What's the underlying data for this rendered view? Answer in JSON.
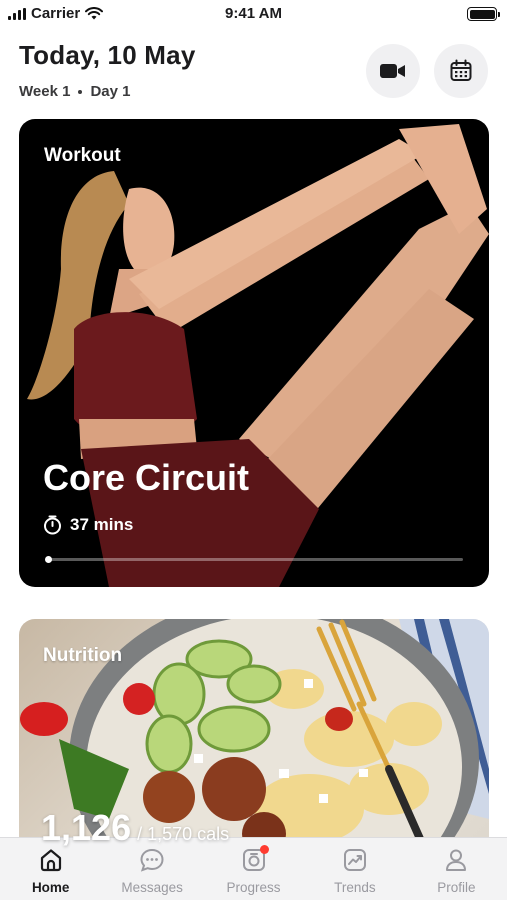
{
  "status_bar": {
    "carrier": "Carrier",
    "time": "9:41 AM"
  },
  "header": {
    "date": "Today, 10 May",
    "week": "Week 1",
    "day": "Day 1"
  },
  "header_actions": {
    "video_icon": "video-camera-icon",
    "calendar_icon": "calendar-icon"
  },
  "workout": {
    "label": "Workout",
    "title": "Core Circuit",
    "duration": "37 mins",
    "progress": 0.0
  },
  "nutrition": {
    "label": "Nutrition",
    "calories": "1,126",
    "calories_goal": "/ 1,570 cals"
  },
  "tabs": [
    {
      "label": "Home",
      "icon": "home-icon",
      "active": true
    },
    {
      "label": "Messages",
      "icon": "chat-icon",
      "active": false
    },
    {
      "label": "Progress",
      "icon": "camera-icon",
      "active": false,
      "badge": true
    },
    {
      "label": "Trends",
      "icon": "trend-chart-icon",
      "active": false
    },
    {
      "label": "Profile",
      "icon": "person-icon",
      "active": false
    }
  ],
  "colors": {
    "accent_badge": "#ff3b30",
    "active_tab": "#1c1c1e",
    "inactive_tab": "#9a9aa0"
  }
}
